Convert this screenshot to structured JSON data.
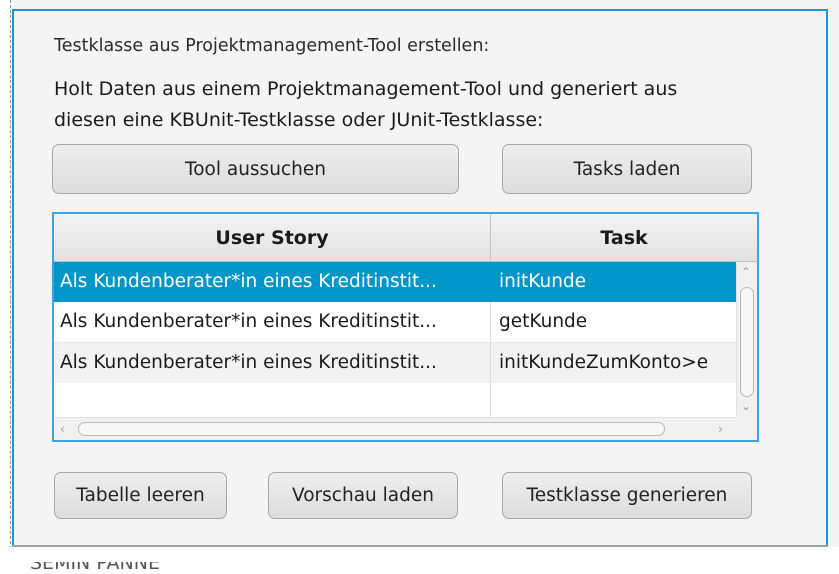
{
  "heading": "Testklasse aus Projektmanagement-Tool erstellen:",
  "description_line1": "Holt Daten aus einem Projektmanagement-Tool und generiert aus",
  "description_line2": "diesen eine KBUnit-Testklasse oder JUnit-Testklasse:",
  "buttons": {
    "choose_tool": "Tool aussuchen",
    "load_tasks": "Tasks laden",
    "clear_table": "Tabelle leeren",
    "load_preview": "Vorschau laden",
    "generate_testclass": "Testklasse generieren"
  },
  "table": {
    "columns": [
      "User Story",
      "Task"
    ],
    "rows": [
      {
        "user_story": "Als Kundenberater*in eines Kreditinstit...",
        "task": "initKunde",
        "selected": true
      },
      {
        "user_story": "Als Kundenberater*in eines Kreditinstit...",
        "task": "getKunde",
        "selected": false
      },
      {
        "user_story": "Als Kundenberater*in eines Kreditinstit...",
        "task": "initKundeZumKonto>e",
        "selected": false
      }
    ]
  },
  "bottom_cut_text": "SEMIN PANNE",
  "colors": {
    "accent": "#1b95d6",
    "selection": "#0096c9"
  }
}
